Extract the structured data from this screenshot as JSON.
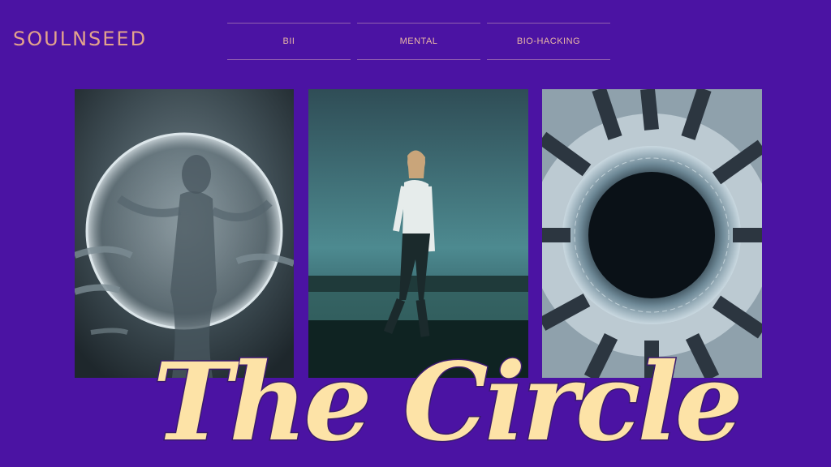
{
  "header": {
    "brand": "SOULNSEED",
    "nav": [
      {
        "label": "BII"
      },
      {
        "label": "MENTAL"
      },
      {
        "label": "BIO-HACKING"
      }
    ]
  },
  "hero": {
    "title": "The Circle"
  },
  "colors": {
    "background": "#4b13a3",
    "brand": "#e3a38c",
    "title": "#fde3a7",
    "title_outline": "#3a1a6e"
  }
}
